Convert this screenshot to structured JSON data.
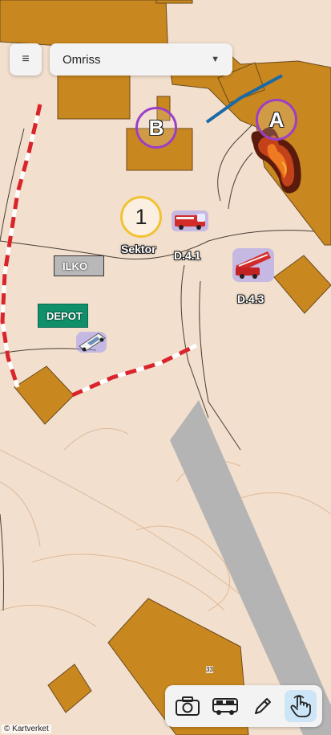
{
  "header": {
    "menu_icon": "hamburger-icon",
    "menu_glyph": "≡",
    "layer_select": {
      "selected": "Omriss",
      "caret": "▼"
    }
  },
  "markers": {
    "sector": {
      "number": "1",
      "label": "Sektor"
    },
    "point_a": "A",
    "point_b": "B"
  },
  "labels": {
    "ilko": "ILKO",
    "depot": "DEPOT",
    "unit_1": "D.4.1",
    "unit_3": "D.4.3"
  },
  "icons": {
    "fire_truck_1": "fire-truck-icon",
    "fire_truck_2": "ladder-truck-icon",
    "car": "car-icon",
    "fire": "fire-icon"
  },
  "toolbar": {
    "tools": [
      "camera",
      "vehicle",
      "pencil",
      "pointer"
    ],
    "active": "pointer"
  },
  "map": {
    "road_number": "33",
    "attribution": "© Kartverket"
  },
  "colors": {
    "background": "#f2dfcd",
    "building": "#c8871f",
    "road": "#b4b4b4",
    "sector_ring": "#f1c232",
    "point_ring": "#9b3fc9",
    "depot": "#0f8f6a",
    "ilko": "#b8b8b8",
    "active_tool": "#cde6f7"
  }
}
